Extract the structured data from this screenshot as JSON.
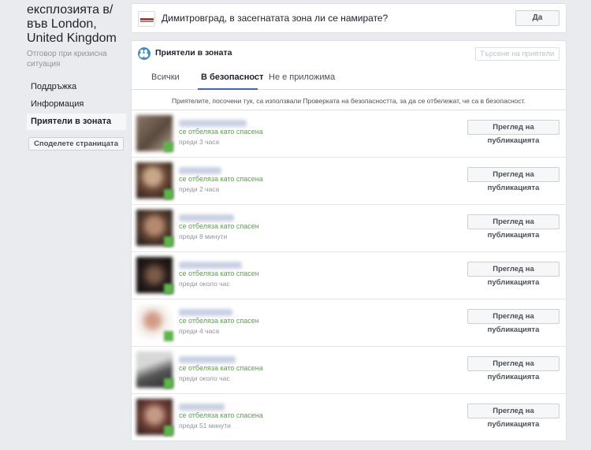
{
  "sidebar": {
    "title": "експлозията в/във London, United Kingdom",
    "subtitle": "Отговор при кризисна ситуация",
    "items": [
      {
        "label": "Поддръжка",
        "active": false
      },
      {
        "label": "Информация",
        "active": false
      },
      {
        "label": "Приятели в зоната",
        "active": true
      }
    ],
    "share_label": "Споделете страницата"
  },
  "prompt": {
    "badge_icon": "city-badge-icon",
    "text": "Димитровград, в засегнатата зона ли се намирате?",
    "yes_label": "Да"
  },
  "main": {
    "header_icon": "friends-icon",
    "title": "Приятели в зоната",
    "search_placeholder": "Търсене на приятели",
    "tabs": [
      {
        "label": "Всички",
        "active": false
      },
      {
        "label": "В безопасност",
        "active": true
      },
      {
        "label": "Не е приложима",
        "active": false
      }
    ],
    "notice": "Приятелите, посочени тук, са използвали Проверката на безопасността, за да се отбележат, че са в безопасност.",
    "view_label": "Преглед на публикацията",
    "friends": [
      {
        "status": "се отбеляза като спасена",
        "time": "преди 3 часа"
      },
      {
        "status": "се отбеляза като спасена",
        "time": "преди 2 часа"
      },
      {
        "status": "се отбеляза като спасен",
        "time": "преди 8 минути"
      },
      {
        "status": "се отбеляза като спасен",
        "time": "преди около час"
      },
      {
        "status": "се отбеляза като спасен",
        "time": "преди 4 часа"
      },
      {
        "status": "се отбеляза като спасена",
        "time": "преди около час"
      },
      {
        "status": "се отбеляза като спасена",
        "time": "преди 51 минути"
      }
    ]
  },
  "colors": {
    "accent": "#4267b2",
    "safe_green": "#4fa83d",
    "background": "#e9ebee"
  }
}
